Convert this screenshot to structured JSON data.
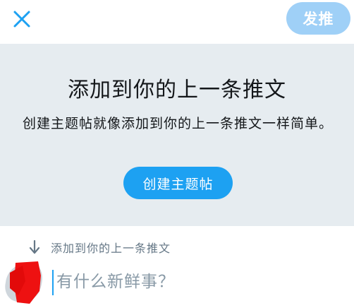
{
  "header": {
    "close_icon": "close-icon",
    "post_label": "发推",
    "post_color": "#9fd0f7"
  },
  "panel": {
    "title": "添加到你的上一条推文",
    "description": "创建主题帖就像添加到你的上一条推文一样简单。",
    "create_button_label": "创建主题帖",
    "accent_color": "#1da1f2",
    "background_color": "#e6ecf0"
  },
  "reply_context": {
    "icon": "arrow-down-icon",
    "label": "添加到你的上一条推文"
  },
  "composer": {
    "avatar_icon": "avatar",
    "placeholder": "有什么新鲜事？",
    "value": ""
  }
}
